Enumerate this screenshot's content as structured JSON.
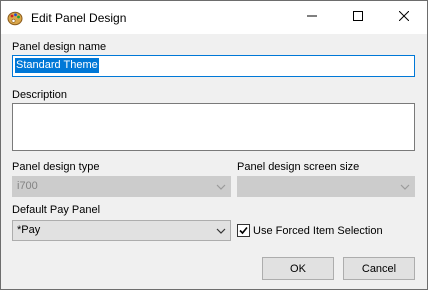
{
  "window": {
    "title": "Edit Panel Design",
    "icon": "palette-icon",
    "controls": [
      "minimize-icon",
      "maximize-icon",
      "close-icon"
    ]
  },
  "form": {
    "panel_design_name_label": "Panel design name",
    "panel_design_name_value": "Standard Theme",
    "description_label": "Description",
    "description_value": "",
    "panel_design_type_label": "Panel design type",
    "panel_design_type_value": "i700",
    "panel_design_screen_size_label": "Panel design screen size",
    "panel_design_screen_size_value": "",
    "default_pay_panel_label": "Default Pay Panel",
    "default_pay_panel_value": "*Pay",
    "use_forced_item_selection_label": "Use Forced Item Selection",
    "use_forced_item_selection_checked": true
  },
  "buttons": {
    "ok": "OK",
    "cancel": "Cancel"
  },
  "colors": {
    "accent": "#0078d7",
    "dialog_bg": "#f0f0f0",
    "disabled_bg": "#cccccc"
  }
}
